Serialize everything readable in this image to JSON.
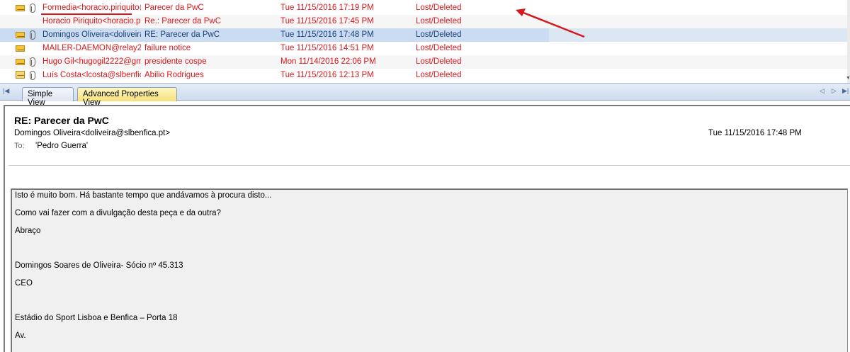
{
  "messages": [
    {
      "from": "Formedia<horacio.piriquito@...",
      "subject": "Parecer da PwC",
      "date": "Tue 11/15/2016 17:19 PM",
      "status": "Lost/Deleted"
    },
    {
      "from": "Horacio Piriquito<horacio.piri...",
      "subject": "Re.: Parecer da PwC",
      "date": "Tue 11/15/2016 17:45 PM",
      "status": "Lost/Deleted"
    },
    {
      "from": "Domingos Oliveira<doliveira...",
      "subject": "RE: Parecer da PwC",
      "date": "Tue 11/15/2016 17:48 PM",
      "status": "Lost/Deleted"
    },
    {
      "from": "MAILER-DAEMON@relay2....",
      "subject": "failure notice",
      "date": "Tue 11/15/2016 14:51 PM",
      "status": "Lost/Deleted"
    },
    {
      "from": "Hugo Gil<hugogil2222@gm...",
      "subject": "presidente cospe",
      "date": "Mon 11/14/2016 22:06 PM",
      "status": "Lost/Deleted"
    },
    {
      "from": "Luís Costa<lcosta@slbenfic...",
      "subject": "Abilio Rodrigues",
      "date": "Tue 11/15/2016 12:13 PM",
      "status": "Lost/Deleted"
    }
  ],
  "tabs": {
    "simple": "Simple View",
    "advanced": "Advanced Properties View"
  },
  "preview": {
    "subject": "RE: Parecer da PwC",
    "from": "Domingos Oliveira<doliveira@slbenfica.pt>",
    "date": "Tue 11/15/2016 17:48 PM",
    "to_label": "To:",
    "to": "'Pedro Guerra'"
  },
  "body_lines": [
    "Isto é muito bom. Há bastante tempo que andávamos à procura disto...",
    "Como vai fazer com a divulgação desta peça e da outra?",
    "Abraço",
    "Domingos Soares de Oliveira- Sócio nº 45.313",
    "CEO",
    "Estádio do Sport Lisboa e Benfica – Porta 18",
    "Av."
  ],
  "colors": {
    "deleted_text": "#d8171b",
    "selected_text": "#1e3f7a",
    "annotation": "#d8171b"
  }
}
